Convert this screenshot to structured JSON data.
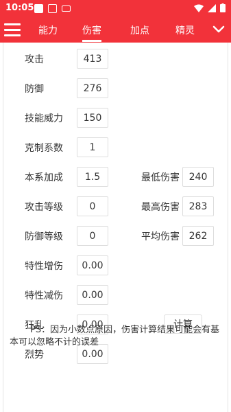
{
  "status": {
    "time": "10:05"
  },
  "tabs": [
    {
      "label": "能力"
    },
    {
      "label": "伤害"
    },
    {
      "label": "加点"
    },
    {
      "label": "精灵"
    }
  ],
  "fields": [
    {
      "label": "攻击",
      "value": "413"
    },
    {
      "label": "防御",
      "value": "276"
    },
    {
      "label": "技能威力",
      "value": "150"
    },
    {
      "label": "克制系数",
      "value": "1"
    },
    {
      "label": "本系加成",
      "value": "1.5"
    },
    {
      "label": "攻击等级",
      "value": "0"
    },
    {
      "label": "防御等级",
      "value": "0"
    },
    {
      "label": "特性增伤",
      "value": "0.00"
    },
    {
      "label": "特性减伤",
      "value": "0.00"
    },
    {
      "label": "狂乱",
      "value": "0.00"
    },
    {
      "label": "烈势",
      "value": "0.00"
    }
  ],
  "results": [
    {
      "label": "最低伤害",
      "value": "240"
    },
    {
      "label": "最高伤害",
      "value": "283"
    },
    {
      "label": "平均伤害",
      "value": "262"
    }
  ],
  "calc_button": "计算",
  "note": "PS：因为小数点原因，伤害计算结果可能会有基本可以忽略不计的误差",
  "colors": {
    "accent": "#f2323a"
  }
}
